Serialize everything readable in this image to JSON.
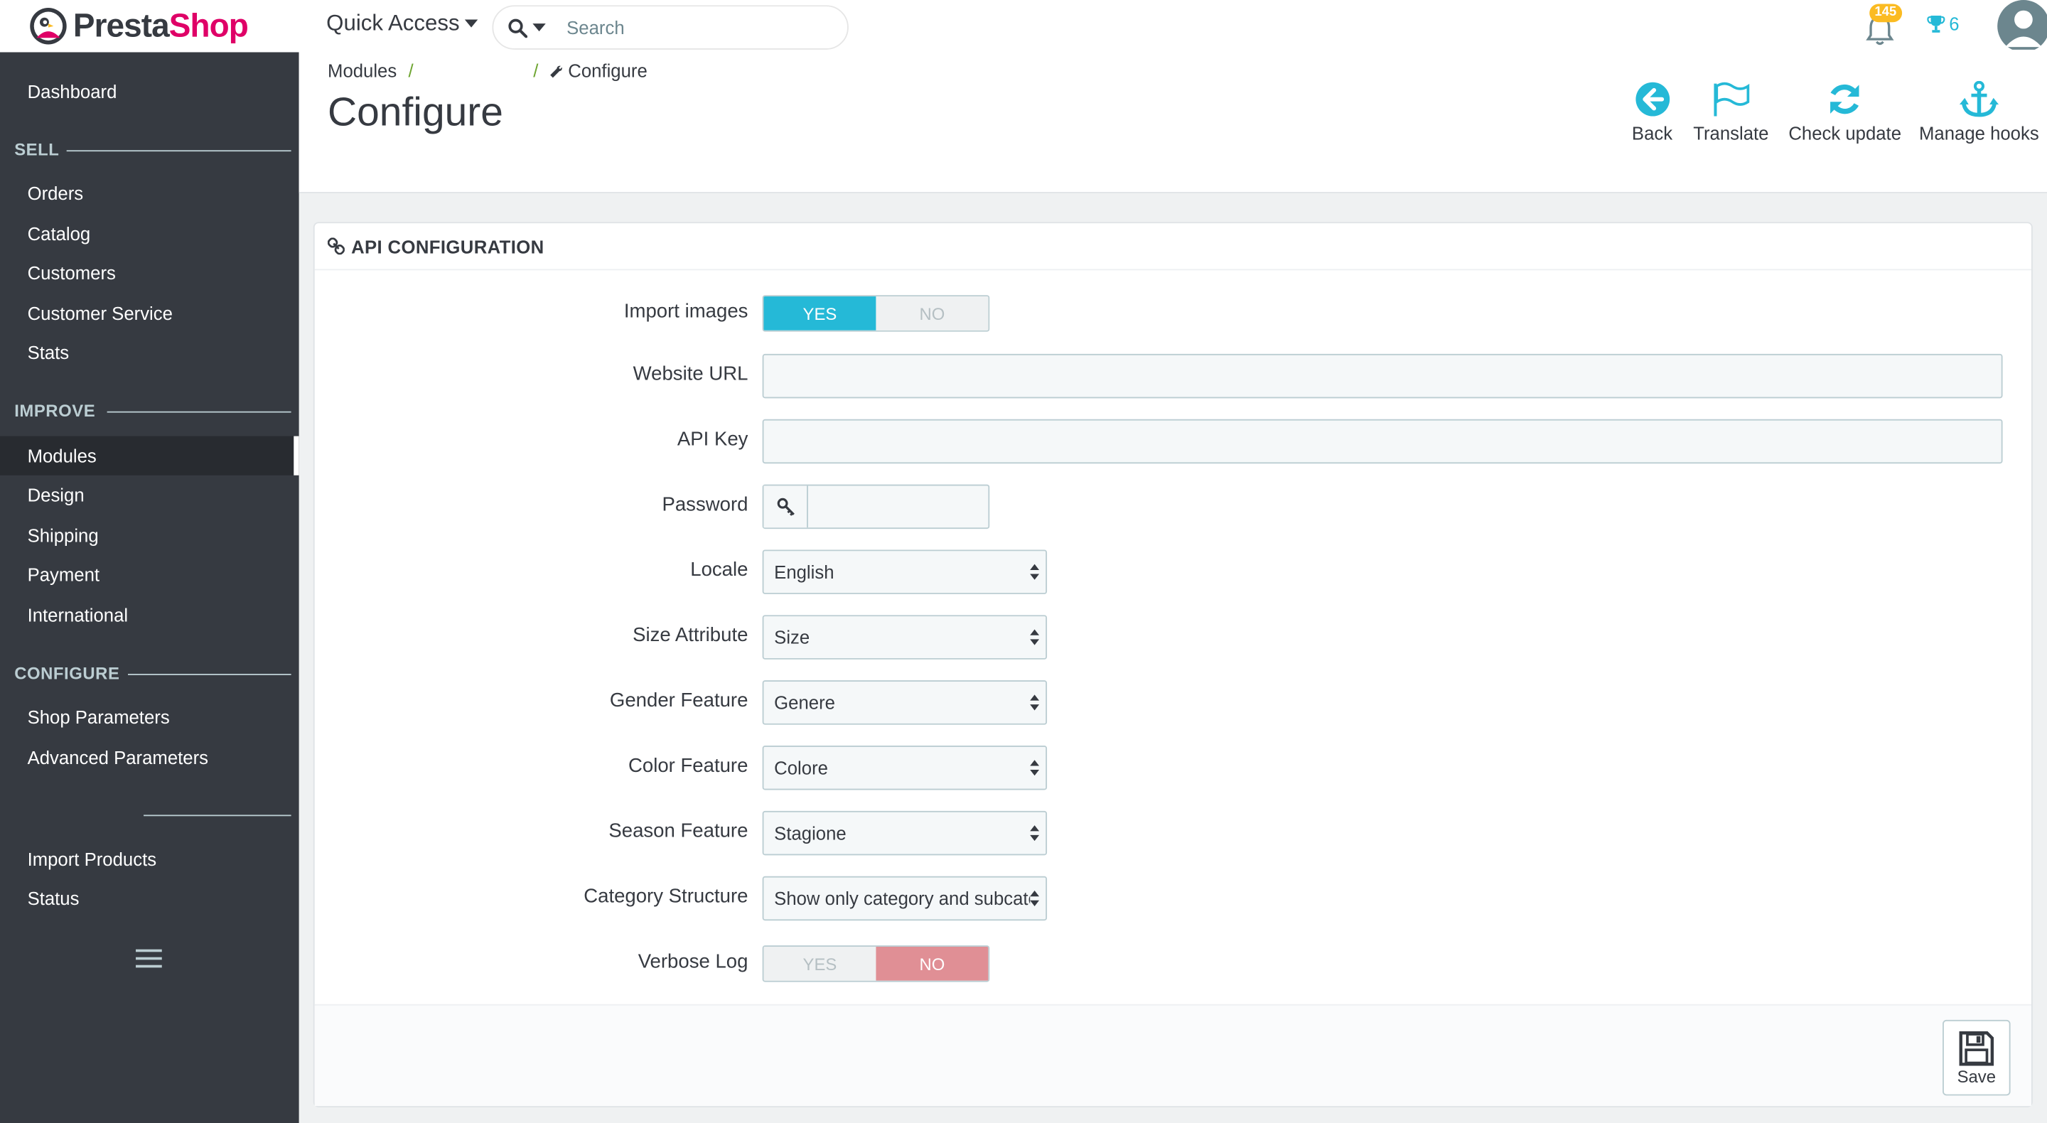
{
  "brand": {
    "name_part1": "Presta",
    "name_part2": "Shop"
  },
  "header": {
    "quick_access": "Quick Access",
    "search_placeholder": "Search",
    "notifications_count": "145",
    "trophy_count": "6"
  },
  "sidebar": {
    "dashboard": "Dashboard",
    "sections": {
      "sell": "SELL",
      "improve": "IMPROVE",
      "configure": "CONFIGURE"
    },
    "sell_items": [
      "Orders",
      "Catalog",
      "Customers",
      "Customer Service",
      "Stats"
    ],
    "improve_items": [
      "Modules",
      "Design",
      "Shipping",
      "Payment",
      "International"
    ],
    "configure_items": [
      "Shop Parameters",
      "Advanced Parameters"
    ],
    "extra_items": [
      "Import Products",
      "Status"
    ]
  },
  "page": {
    "breadcrumb": {
      "first": "Modules",
      "sep": "/",
      "last": "Configure"
    },
    "title": "Configure",
    "toolbar": {
      "back": "Back",
      "translate": "Translate",
      "check_update": "Check update",
      "manage_hooks": "Manage hooks"
    }
  },
  "panel": {
    "title": "API CONFIGURATION",
    "fields": {
      "import_images": {
        "label": "Import images",
        "yes": "YES",
        "no": "NO",
        "value": "YES"
      },
      "website_url": {
        "label": "Website URL",
        "value": ""
      },
      "api_key": {
        "label": "API Key",
        "value": ""
      },
      "password": {
        "label": "Password",
        "value": ""
      },
      "locale": {
        "label": "Locale",
        "value": "English"
      },
      "size_attribute": {
        "label": "Size Attribute",
        "value": "Size"
      },
      "gender_feature": {
        "label": "Gender Feature",
        "value": "Genere"
      },
      "color_feature": {
        "label": "Color Feature",
        "value": "Colore"
      },
      "season_feature": {
        "label": "Season Feature",
        "value": "Stagione"
      },
      "category_structure": {
        "label": "Category Structure",
        "value": "Show only category and subcategory"
      },
      "verbose_log": {
        "label": "Verbose Log",
        "yes": "YES",
        "no": "NO",
        "value": "NO"
      }
    },
    "save": "Save"
  },
  "colors": {
    "accent": "#25b9d7",
    "sidebar_bg": "#363a41",
    "brand_pink": "#df0067",
    "danger_toggle": "#e08f95",
    "badge": "#fbbb22"
  },
  "icons": {
    "back": "arrow-circle-left-icon",
    "translate": "flag-icon",
    "check_update": "refresh-icon",
    "manage_hooks": "anchor-icon",
    "panel": "link-icon",
    "password": "key-icon",
    "save": "floppy-disk-icon",
    "notifications": "bell-icon",
    "trophy": "trophy-icon"
  }
}
